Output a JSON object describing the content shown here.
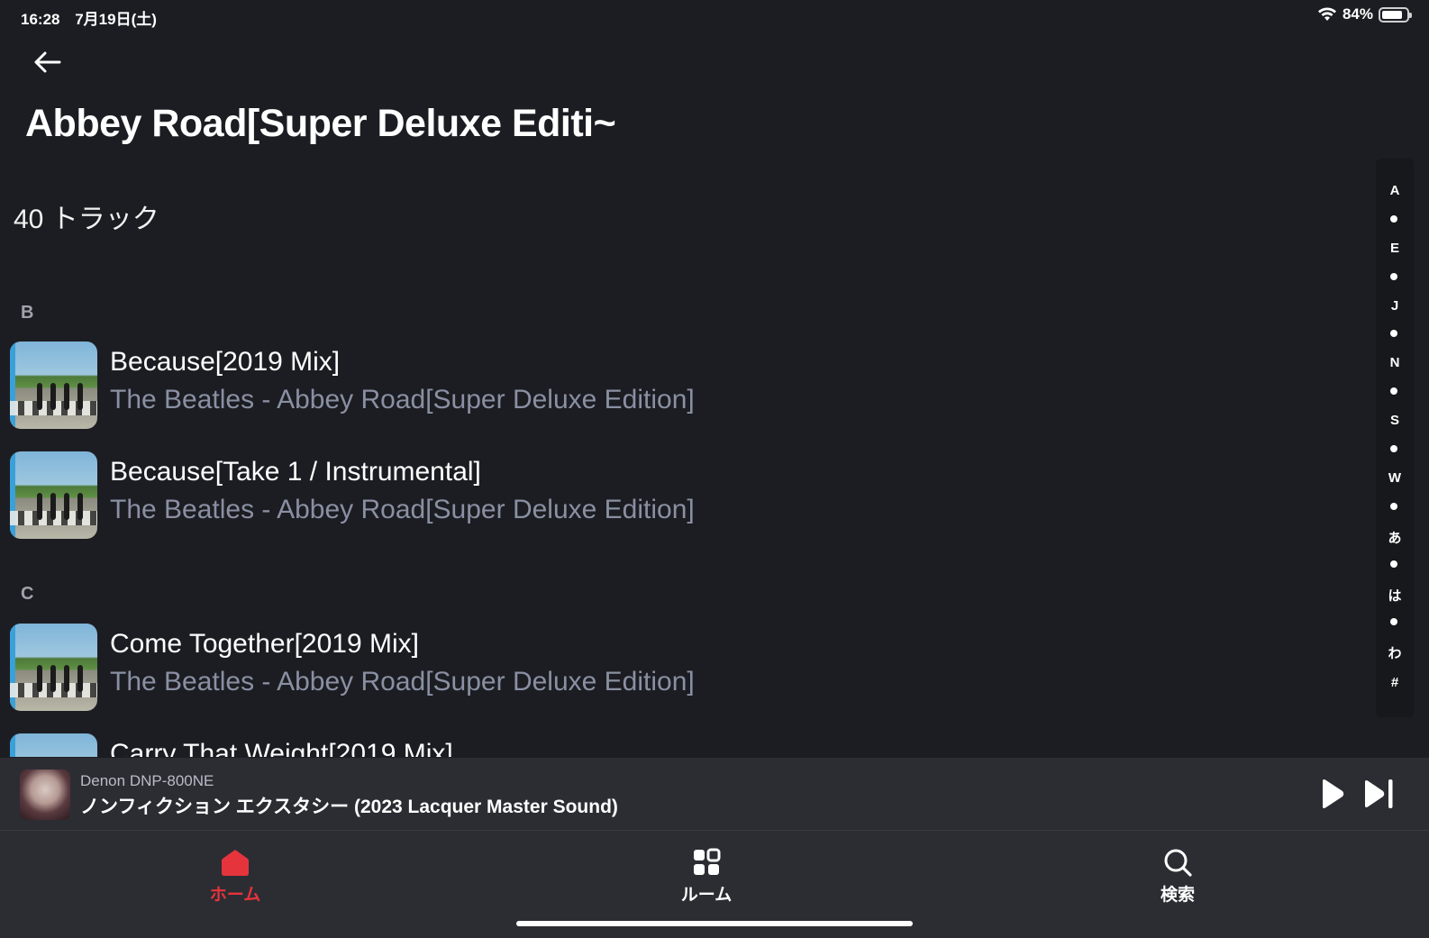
{
  "status_bar": {
    "time": "16:28",
    "date": "7月19日(土)",
    "battery": "84%",
    "battery_level": 0.84
  },
  "header": {
    "title": "Abbey Road[Super Deluxe Editi~",
    "track_count": "40 トラック"
  },
  "sections": [
    {
      "letter": "B",
      "tracks": [
        {
          "title": "Because[2019 Mix]",
          "subtitle": "The Beatles - Abbey Road[Super Deluxe Edition]"
        },
        {
          "title": "Because[Take 1 / Instrumental]",
          "subtitle": "The Beatles - Abbey Road[Super Deluxe Edition]"
        }
      ]
    },
    {
      "letter": "C",
      "tracks": [
        {
          "title": "Come Together[2019 Mix]",
          "subtitle": "The Beatles - Abbey Road[Super Deluxe Edition]"
        },
        {
          "title": "Carry That Weight[2019 Mix]",
          "subtitle": ""
        }
      ]
    }
  ],
  "index_bar": [
    "A",
    "•",
    "E",
    "•",
    "J",
    "•",
    "N",
    "•",
    "S",
    "•",
    "W",
    "•",
    "あ",
    "•",
    "は",
    "•",
    "わ",
    "#"
  ],
  "now_playing": {
    "device": "Denon DNP-800NE",
    "title": "ノンフィクション エクスタシー (2023 Lacquer Master Sound)"
  },
  "tabs": [
    {
      "label": "ホーム",
      "icon": "home-icon",
      "active": true
    },
    {
      "label": "ルーム",
      "icon": "rooms-grid-icon",
      "active": false
    },
    {
      "label": "検索",
      "icon": "search-icon",
      "active": false
    }
  ],
  "colors": {
    "background": "#1c1d22",
    "accent": "#e5343c",
    "secondary_text": "#8a90a3"
  }
}
